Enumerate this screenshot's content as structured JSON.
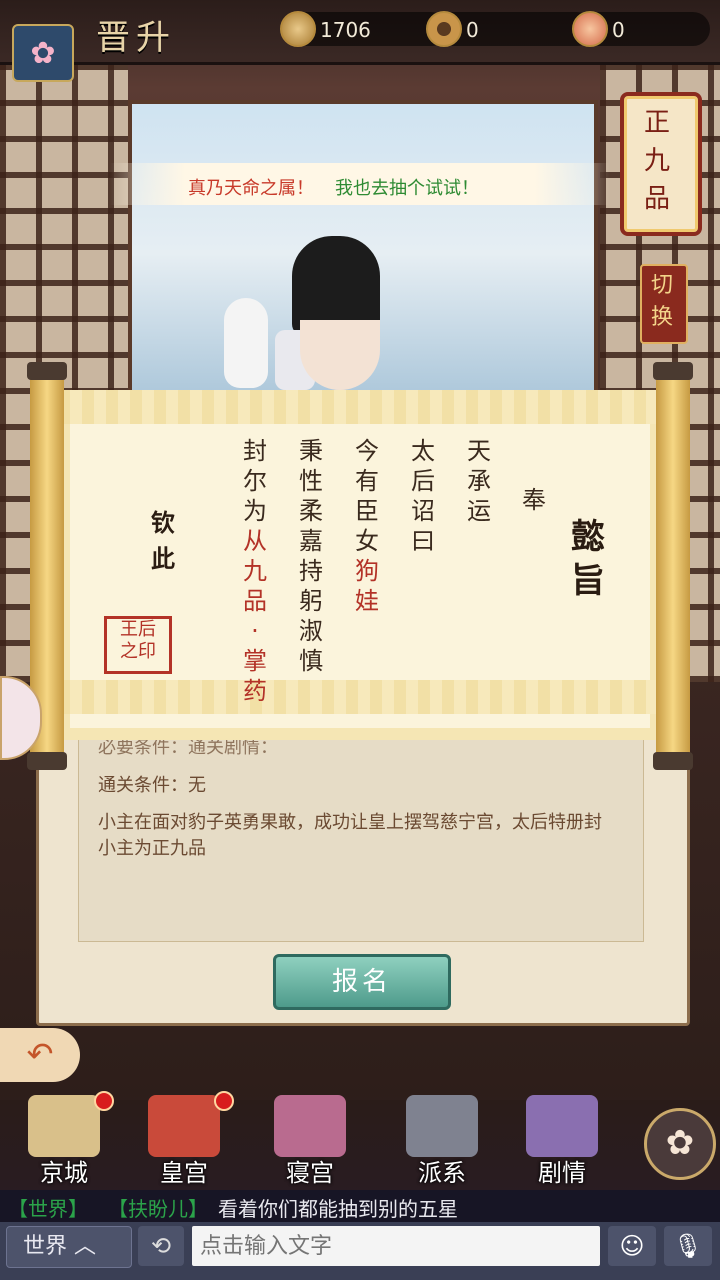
{
  "header": {
    "title": "晋升",
    "resources": [
      {
        "icon": "jade-coin-icon",
        "value": "1706"
      },
      {
        "icon": "copper-coin-icon",
        "value": "0"
      },
      {
        "icon": "gift-icon",
        "value": "0"
      }
    ]
  },
  "banner": {
    "part1": "真乃天命之属！",
    "part2": "我也去抽个试试！"
  },
  "rank_tag": {
    "text": "正九品"
  },
  "switch_tag": {
    "text": "切换"
  },
  "edict": {
    "yizhi": "懿旨",
    "feng": "奉",
    "columns": [
      "天承运",
      "太后诏曰",
      "今有臣女",
      "秉性柔嘉持躬淑慎",
      "封尔为"
    ],
    "name_highlight": "狗娃",
    "rank_highlight": "从九品·掌药",
    "qinci": "钦此",
    "seal": "王后\n之印"
  },
  "panel": {
    "cond1": "必要条件：通关剧情：",
    "cond2": "通关条件：无",
    "desc": "小主在面对豹子英勇果敢，成功让皇上摆驾慈宁宫，太后特册封小主为正九品",
    "signup": "报名"
  },
  "nav": {
    "items": [
      {
        "label": "京城",
        "badge": true
      },
      {
        "label": "皇宫",
        "badge": true
      },
      {
        "label": "寝宫",
        "badge": false
      },
      {
        "label": "派系",
        "badge": false
      },
      {
        "label": "剧情",
        "badge": false
      }
    ]
  },
  "chat": {
    "channel": "【世界】",
    "user": "【扶盼儿】",
    "message": "看着你们都能抽到别的五星",
    "world_selector": "世界 ︿",
    "placeholder": "点击输入文字"
  },
  "colors": {
    "accent_red": "#b33227",
    "chat_green": "#2ba34a",
    "button_teal": "#4e9b8b"
  }
}
